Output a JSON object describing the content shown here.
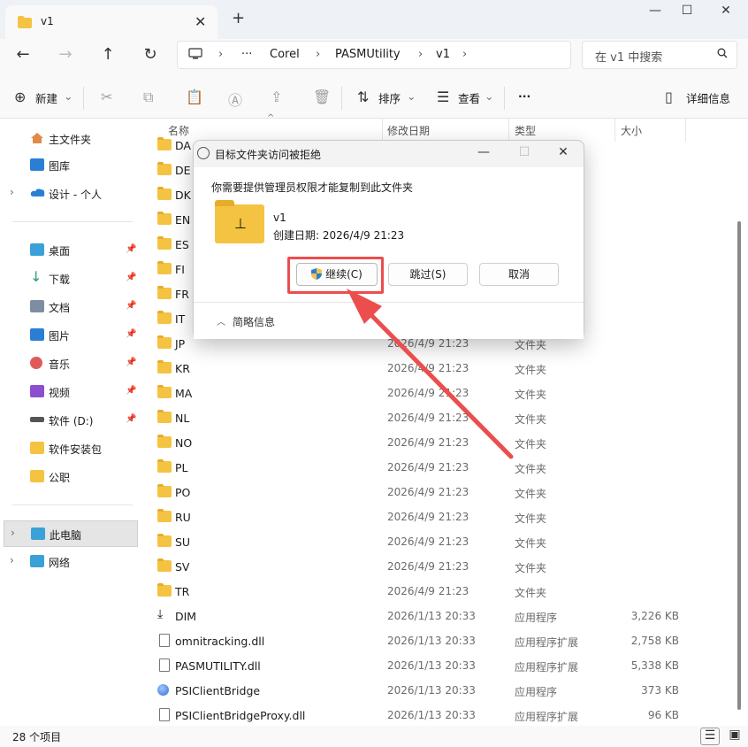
{
  "window": {
    "tab_title": "v1",
    "new_tab_symbol": "+",
    "close_tab_symbol": "✕",
    "min_symbol": "—",
    "max_symbol": "☐",
    "close_symbol": "✕"
  },
  "address_bar": {
    "crumbs": [
      "Corel",
      "PASMUtility",
      "v1"
    ],
    "ellipsis": "···",
    "search_placeholder": "在 v1 中搜索"
  },
  "toolbar": {
    "new_label": "新建",
    "sort_label": "排序",
    "view_label": "查看",
    "more_label": "···",
    "details_label": "详细信息"
  },
  "sidebar": {
    "items": [
      {
        "label": "主文件夹",
        "icon": "home-icon"
      },
      {
        "label": "图库",
        "icon": "gallery-icon"
      },
      {
        "label": "设计 - 个人",
        "icon": "onedrive-icon"
      },
      {
        "label": "桌面",
        "icon": "desktop-icon"
      },
      {
        "label": "下载",
        "icon": "download-icon"
      },
      {
        "label": "文档",
        "icon": "documents-icon"
      },
      {
        "label": "图片",
        "icon": "pictures-icon"
      },
      {
        "label": "音乐",
        "icon": "music-icon"
      },
      {
        "label": "视频",
        "icon": "videos-icon"
      },
      {
        "label": "软件 (D:)",
        "icon": "drive-icon"
      },
      {
        "label": "软件安装包",
        "icon": "folder-icon"
      },
      {
        "label": "公职",
        "icon": "folder-icon"
      },
      {
        "label": "此电脑",
        "icon": "this-pc-icon"
      },
      {
        "label": "网络",
        "icon": "network-icon"
      }
    ]
  },
  "columns": {
    "name": "名称",
    "date": "修改日期",
    "type": "类型",
    "size": "大小"
  },
  "files": [
    {
      "name": "DA",
      "date": "",
      "type": "",
      "size": "",
      "kind": "folder"
    },
    {
      "name": "DE",
      "date": "",
      "type": "",
      "size": "",
      "kind": "folder"
    },
    {
      "name": "DK",
      "date": "",
      "type": "",
      "size": "",
      "kind": "folder"
    },
    {
      "name": "EN",
      "date": "",
      "type": "",
      "size": "",
      "kind": "folder"
    },
    {
      "name": "ES",
      "date": "",
      "type": "",
      "size": "",
      "kind": "folder"
    },
    {
      "name": "FI",
      "date": "",
      "type": "",
      "size": "",
      "kind": "folder"
    },
    {
      "name": "FR",
      "date": "",
      "type": "",
      "size": "",
      "kind": "folder"
    },
    {
      "name": "IT",
      "date": "",
      "type": "",
      "size": "",
      "kind": "folder"
    },
    {
      "name": "JP",
      "date": "2026/4/9 21:23",
      "type": "文件夹",
      "size": "",
      "kind": "folder"
    },
    {
      "name": "KR",
      "date": "2026/4/9 21:23",
      "type": "文件夹",
      "size": "",
      "kind": "folder"
    },
    {
      "name": "MA",
      "date": "2026/4/9 21:23",
      "type": "文件夹",
      "size": "",
      "kind": "folder"
    },
    {
      "name": "NL",
      "date": "2026/4/9 21:23",
      "type": "文件夹",
      "size": "",
      "kind": "folder"
    },
    {
      "name": "NO",
      "date": "2026/4/9 21:23",
      "type": "文件夹",
      "size": "",
      "kind": "folder"
    },
    {
      "name": "PL",
      "date": "2026/4/9 21:23",
      "type": "文件夹",
      "size": "",
      "kind": "folder"
    },
    {
      "name": "PO",
      "date": "2026/4/9 21:23",
      "type": "文件夹",
      "size": "",
      "kind": "folder"
    },
    {
      "name": "RU",
      "date": "2026/4/9 21:23",
      "type": "文件夹",
      "size": "",
      "kind": "folder"
    },
    {
      "name": "SU",
      "date": "2026/4/9 21:23",
      "type": "文件夹",
      "size": "",
      "kind": "folder"
    },
    {
      "name": "SV",
      "date": "2026/4/9 21:23",
      "type": "文件夹",
      "size": "",
      "kind": "folder"
    },
    {
      "name": "TR",
      "date": "2026/4/9 21:23",
      "type": "文件夹",
      "size": "",
      "kind": "folder"
    },
    {
      "name": "DIM",
      "date": "2026/1/13 20:33",
      "type": "应用程序",
      "size": "3,226 KB",
      "kind": "app"
    },
    {
      "name": "omnitracking.dll",
      "date": "2026/1/13 20:33",
      "type": "应用程序扩展",
      "size": "2,758 KB",
      "kind": "dll"
    },
    {
      "name": "PASMUTILITY.dll",
      "date": "2026/1/13 20:33",
      "type": "应用程序扩展",
      "size": "5,338 KB",
      "kind": "dll"
    },
    {
      "name": "PSIClientBridge",
      "date": "2026/1/13 20:33",
      "type": "应用程序",
      "size": "373 KB",
      "kind": "globe"
    },
    {
      "name": "PSIClientBridgeProxy.dll",
      "date": "2026/1/13 20:33",
      "type": "应用程序扩展",
      "size": "96 KB",
      "kind": "dll"
    }
  ],
  "status": {
    "item_count": "28 个项目"
  },
  "dialog": {
    "title": "目标文件夹访问被拒绝",
    "message": "你需要提供管理员权限才能复制到此文件夹",
    "folder_name": "v1",
    "created": "创建日期: 2026/4/9 21:23",
    "continue_label": "继续(C)",
    "skip_label": "跳过(S)",
    "cancel_label": "取消",
    "brief_label": "简略信息"
  },
  "colors": {
    "accent_red": "#ec4d4d",
    "folder": "#f5c342"
  }
}
